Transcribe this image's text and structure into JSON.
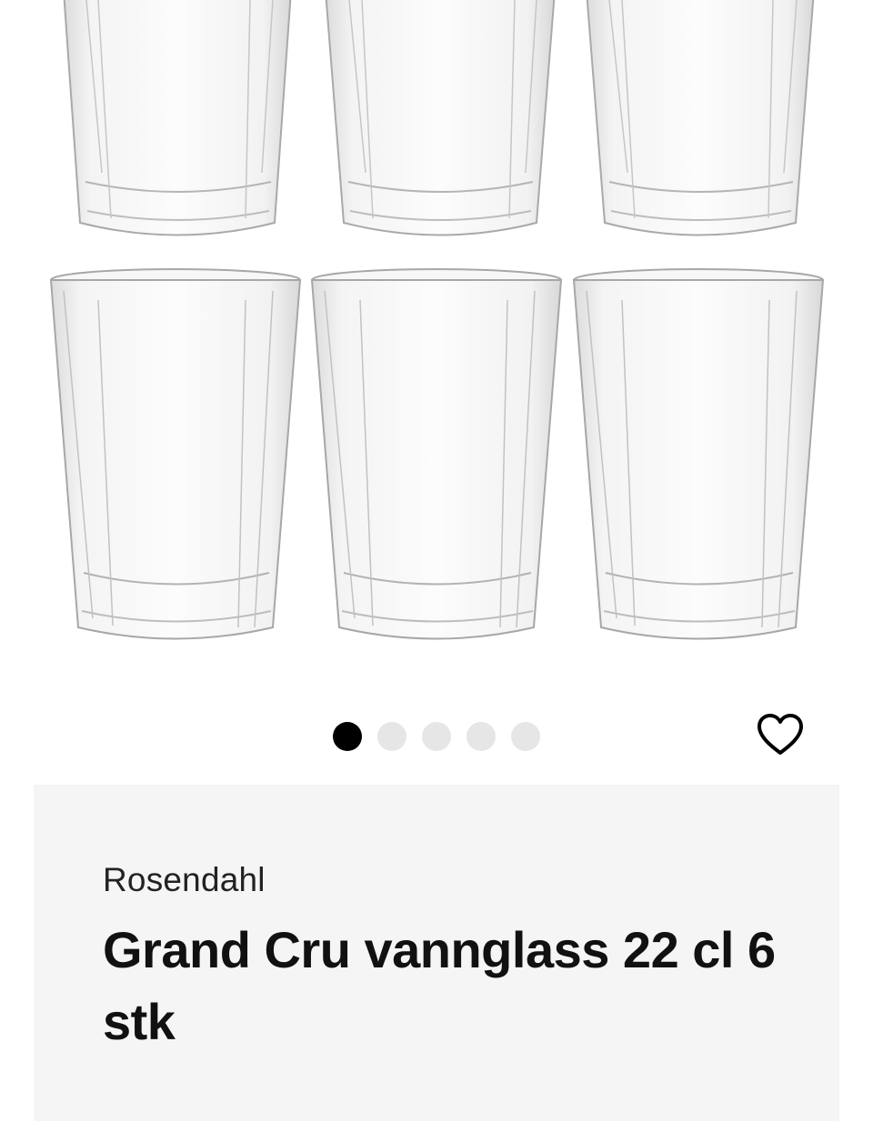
{
  "product": {
    "brand": "Rosendahl",
    "title": "Grand Cru vannglass 22 cl 6 stk"
  },
  "gallery": {
    "image_count": 5,
    "active_index": 0
  },
  "icons": {
    "favorite": "heart-outline-icon"
  },
  "colors": {
    "dot_active": "#000000",
    "dot_inactive": "#e6e6e6",
    "info_background": "#f5f5f5"
  }
}
